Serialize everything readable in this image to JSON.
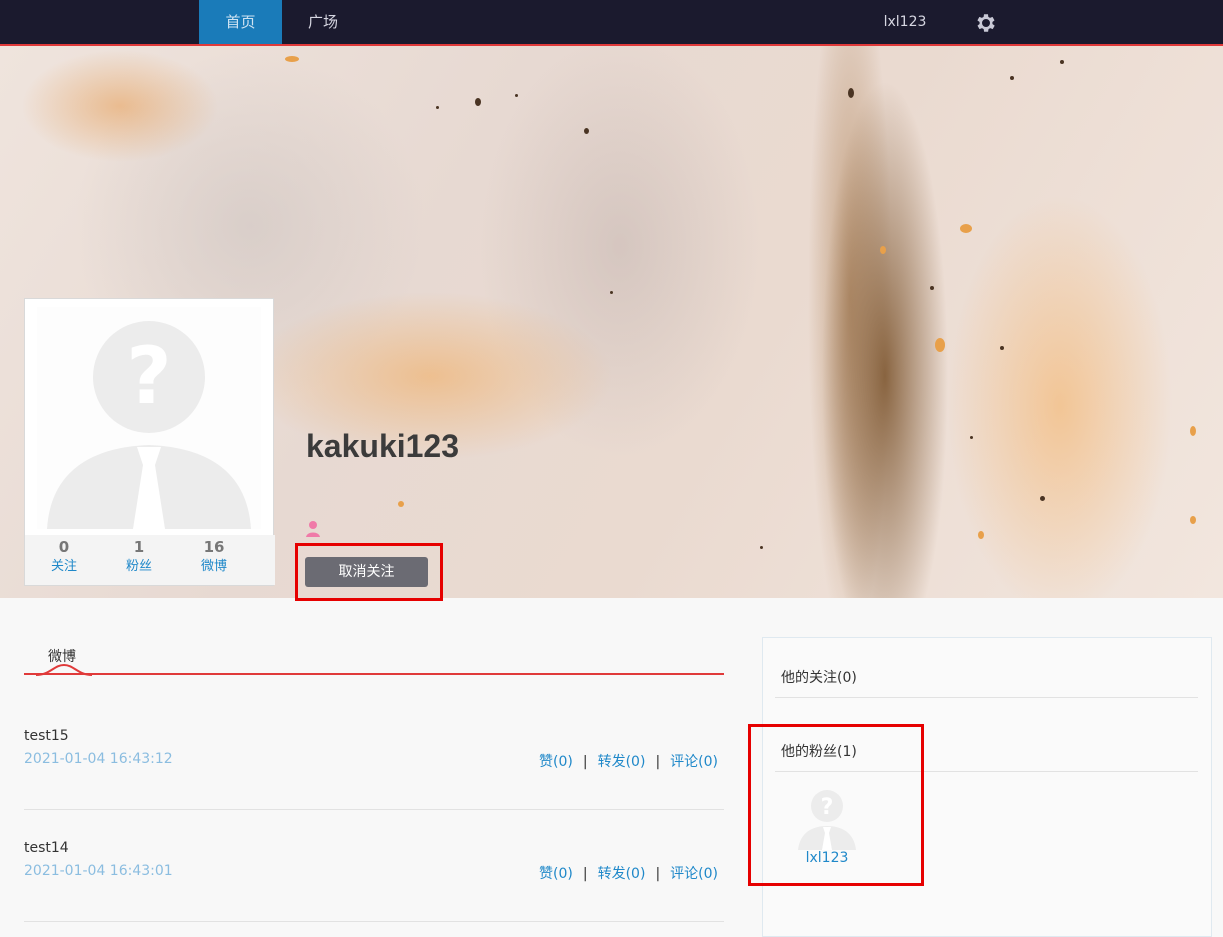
{
  "nav": {
    "home": "首页",
    "square": "广场",
    "user": "lxl123",
    "settings_icon": "gear-icon"
  },
  "profile": {
    "username": "kakuki123",
    "gender_icon": "female-user-icon",
    "unfollow_label": "取消关注",
    "stats": [
      {
        "value": "0",
        "label": "关注"
      },
      {
        "value": "1",
        "label": "粉丝"
      },
      {
        "value": "16",
        "label": "微博"
      }
    ]
  },
  "posts": {
    "tab_label": "微博",
    "items": [
      {
        "title": "test15",
        "time": "2021-01-04 16:43:12",
        "like": "赞(0)",
        "repost": "转发(0)",
        "comment": "评论(0)",
        "sep": "|"
      },
      {
        "title": "test14",
        "time": "2021-01-04 16:43:01",
        "like": "赞(0)",
        "repost": "转发(0)",
        "comment": "评论(0)",
        "sep": "|"
      }
    ]
  },
  "sidebar": {
    "following_title": "他的关注(0)",
    "fans_title": "他的粉丝(1)",
    "fans": [
      {
        "name": "lxl123"
      }
    ]
  },
  "colors": {
    "nav_bg": "#1b1a2e",
    "nav_active": "#1a7bb9",
    "accent_red": "#e03a3a",
    "link_blue": "#1f88c9",
    "highlight": "#e60000"
  }
}
